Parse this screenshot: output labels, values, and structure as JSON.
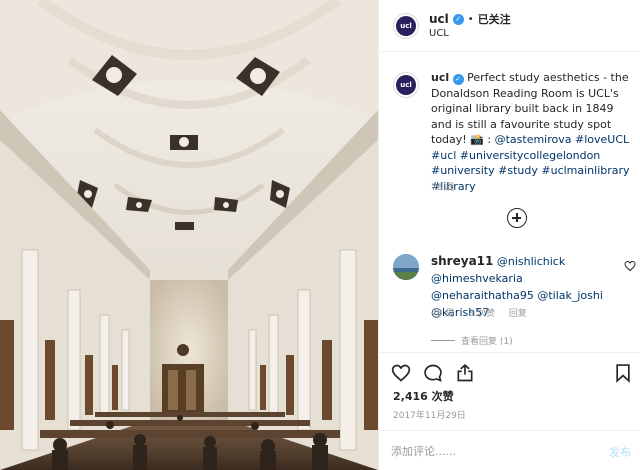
{
  "header": {
    "handle": "ucl",
    "separator": "•",
    "follow_status": "已关注",
    "location": "UCL",
    "avatar_text": "ucl"
  },
  "caption": {
    "handle": "ucl",
    "text": "Perfect study aesthetics - the Donaldson Reading Room is UCL's original library built back in 1849 and is still a favourite study spot today! 📸 :",
    "tags": [
      "@tastemirova",
      "#loveUCL",
      "#ucl",
      "#universitycollegelondon",
      "#university",
      "#study",
      "#uclmainlibrary",
      "#library"
    ],
    "time": "78 周"
  },
  "comment": {
    "handle": "shreya11",
    "mentions": [
      "@nishlichick",
      "@himeshvekaria",
      "@neharaithatha95",
      "@tilak_joshi",
      "@karish57"
    ],
    "time": "78 周",
    "likes": "3 次赞",
    "reply": "回复",
    "view_replies": "查看回复 (1)"
  },
  "post": {
    "likes": "2,416 次赞",
    "date": "2017年11月29日"
  },
  "add_comment": {
    "placeholder": "添加评论......",
    "post_label": "发布"
  },
  "icons": {
    "verified": "verified-badge-icon",
    "load_more": "plus-circle-icon",
    "like": "heart-icon",
    "comment": "comment-bubble-icon",
    "share": "share-icon",
    "save": "bookmark-icon"
  },
  "colors": {
    "verified": "#3897f0",
    "link": "#003569",
    "muted": "#999999",
    "post_disabled": "#b2dffc"
  }
}
